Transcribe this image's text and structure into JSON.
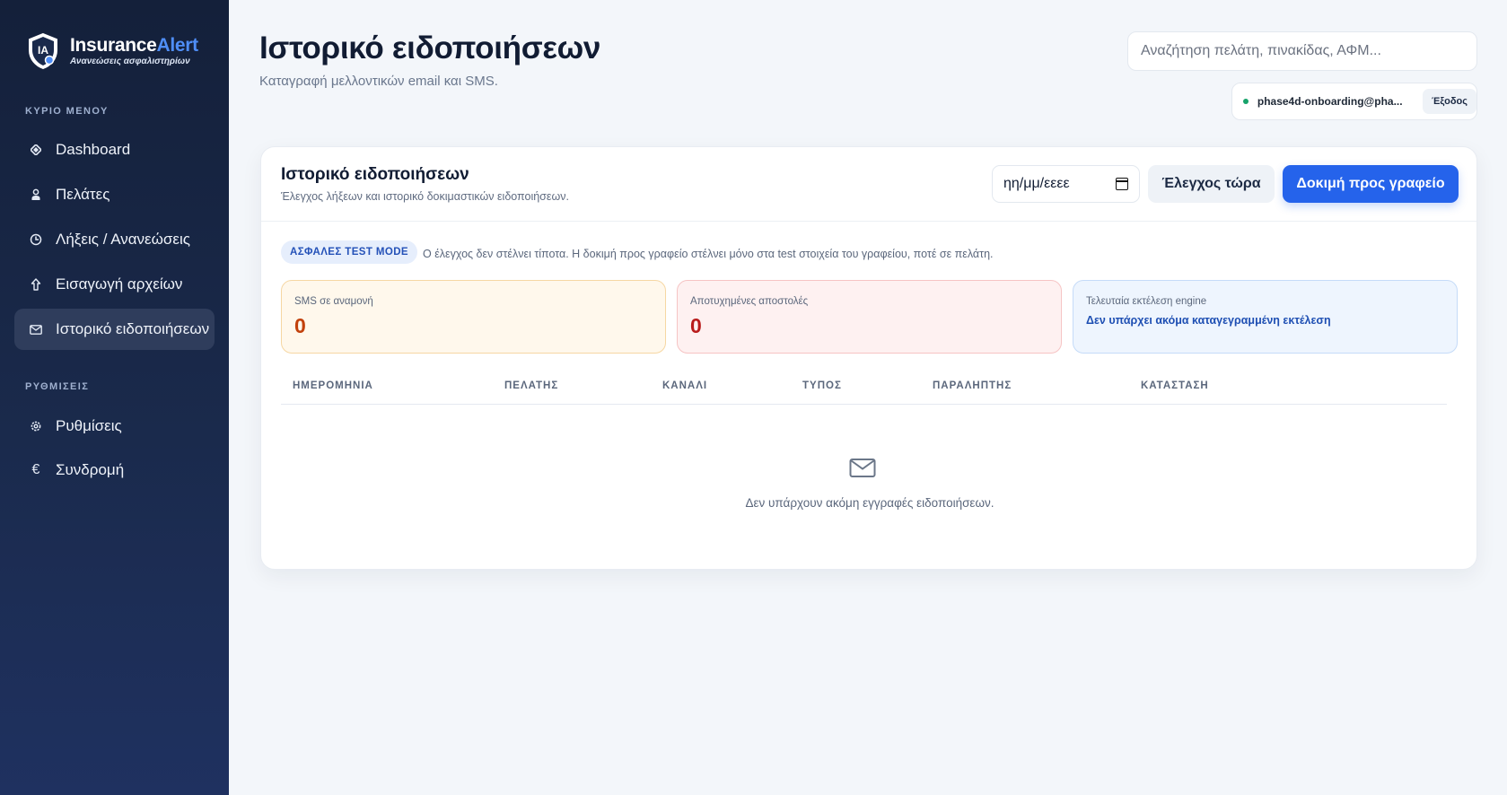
{
  "brand": {
    "name_part1": "Insurance",
    "name_part2": "Alert",
    "tagline": "Ανανεώσεις ασφαλιστηρίων",
    "logo_text": "IA",
    "accent_color": "#4f8ef7"
  },
  "sidebar": {
    "section_main": "ΚΥΡΙΟ ΜΕΝΟΥ",
    "items": [
      {
        "label": "Dashboard",
        "icon": "diamond-icon"
      },
      {
        "label": "Πελάτες",
        "icon": "person-icon"
      },
      {
        "label": "Λήξεις / Ανανεώσεις",
        "icon": "clock-icon"
      },
      {
        "label": "Εισαγωγή αρχείων",
        "icon": "upload-icon"
      },
      {
        "label": "Ιστορικό ειδοποιήσεων",
        "icon": "mail-icon",
        "active": true
      }
    ],
    "section_settings": "ΡΥΘΜΙΣΕΙΣ",
    "settings_items": [
      {
        "label": "Ρυθμίσεις",
        "icon": "gear-icon"
      },
      {
        "label": "Συνδρομή",
        "icon": "euro-icon"
      }
    ]
  },
  "header": {
    "title": "Ιστορικό ειδοποιήσεων",
    "subtitle": "Καταγραφή μελλοντικών email και SMS.",
    "search_placeholder": "Αναζήτηση πελάτη, πινακίδας, ΑΦΜ...",
    "user_email": "phase4d-onboarding@pha...",
    "logout_label": "Έξοδος"
  },
  "card": {
    "title": "Ιστορικό ειδοποιήσεων",
    "subtitle": "Έλεγχος λήξεων και ιστορικό δοκιμαστικών ειδοποιήσεων.",
    "date_placeholder": "ηη/μμ/εεεε",
    "check_label": "Έλεγχος τώρα",
    "test_label": "Δοκιμή προς γραφείο",
    "badge": "ΑΣΦΑΛΕΣ TEST MODE",
    "notice": "Ο έλεγχος δεν στέλνει τίποτα. Η δοκιμή προς γραφείο στέλνει μόνο στα test στοιχεία του γραφείου, ποτέ σε πελάτη.",
    "stats": {
      "sms_label": "SMS σε αναμονή",
      "sms_value": "0",
      "failed_label": "Αποτυχημένες αποστολές",
      "failed_value": "0",
      "engine_label": "Τελευταία εκτέλεση engine",
      "engine_value": "Δεν υπάρχει ακόμα καταγεγραμμένη εκτέλεση"
    },
    "table": {
      "columns": [
        "ΗΜΕΡΟΜΗΝΙΑ",
        "ΠΕΛΑΤΗΣ",
        "ΚΑΝΑΛΙ",
        "ΤΥΠΟΣ",
        "ΠΑΡΑΛΗΠΤΗΣ",
        "ΚΑΤΑΣΤΑΣΗ"
      ],
      "rows": [],
      "empty_text": "Δεν υπάρχουν ακόμη εγγραφές ειδοποιήσεων."
    }
  }
}
